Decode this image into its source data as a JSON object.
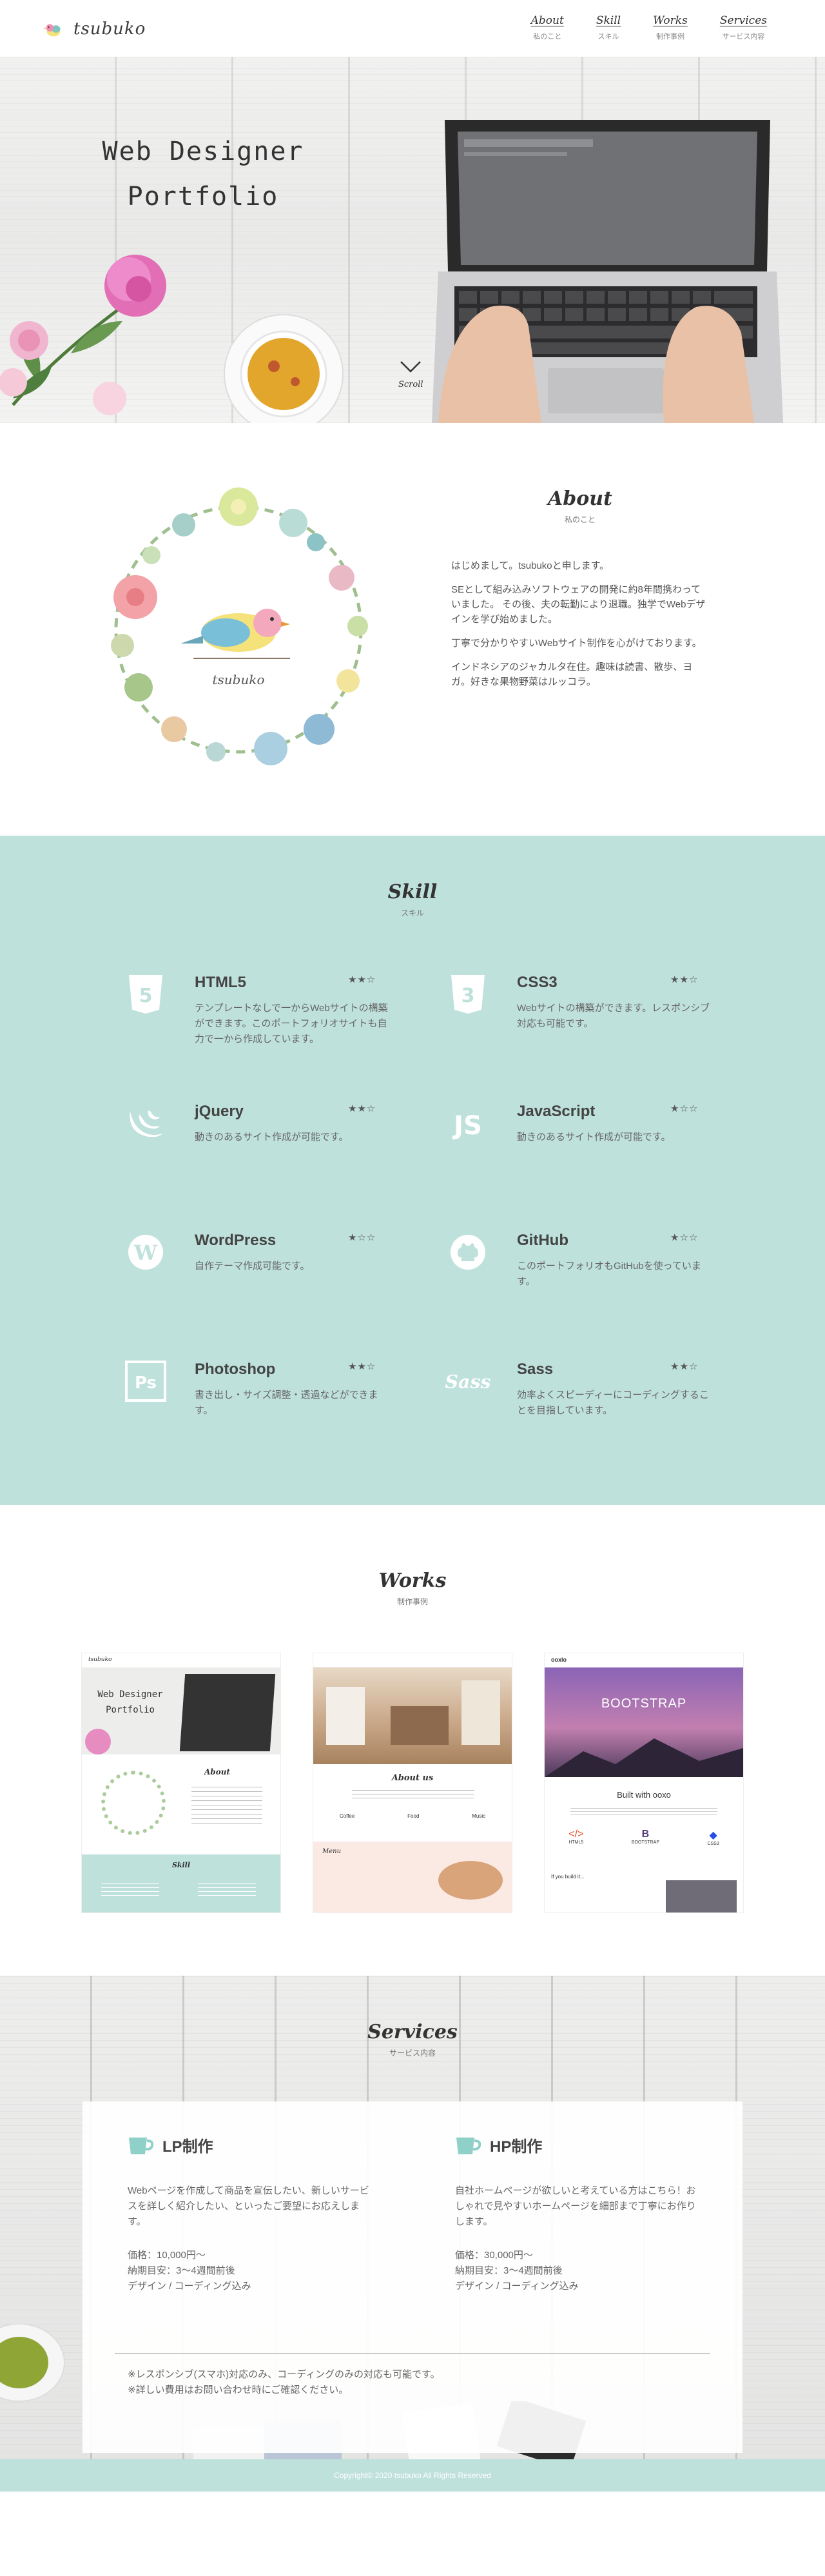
{
  "header": {
    "logo_text": "tsubuko",
    "nav": [
      {
        "label": "About",
        "sub": "私のこと"
      },
      {
        "label": "Skill",
        "sub": "スキル"
      },
      {
        "label": "Works",
        "sub": "制作事例"
      },
      {
        "label": "Services",
        "sub": "サービス内容"
      }
    ]
  },
  "hero": {
    "title_line1": "Web Designer",
    "title_line2": "Portfolio",
    "scroll_label": "Scroll"
  },
  "about": {
    "title": "About",
    "subtitle": "私のこと",
    "wreath_signature": "tsubuko",
    "paragraphs": [
      "はじめまして。tsubukoと申します。",
      "SEとして組み込みソフトウェアの開発に約8年間携わっていました。 その後、夫の転勤により退職。独学でWebデザインを学び始めました。",
      "丁寧で分かりやすいWebサイト制作を心がけております。",
      "インドネシアのジャカルタ在住。趣味は読書、散歩、ヨガ。好きな果物野菜はルッコラ。"
    ]
  },
  "skill": {
    "title": "Skill",
    "subtitle": "スキル",
    "items": [
      {
        "name": "HTML5",
        "stars": "★★☆",
        "desc": "テンプレートなしで一からWebサイトの構築ができます。このポートフォリオサイトも自力で一から作成しています。",
        "icon": "html5-icon"
      },
      {
        "name": "CSS3",
        "stars": "★★☆",
        "desc": "Webサイトの構築ができます。レスポンシブ対応も可能です。",
        "icon": "css3-icon"
      },
      {
        "name": "jQuery",
        "stars": "★★☆",
        "desc": "動きのあるサイト作成が可能です。",
        "icon": "jquery-icon"
      },
      {
        "name": "JavaScript",
        "stars": "★☆☆",
        "desc": "動きのあるサイト作成が可能です。",
        "icon": "javascript-icon"
      },
      {
        "name": "WordPress",
        "stars": "★☆☆",
        "desc": "自作テーマ作成可能です。",
        "icon": "wordpress-icon"
      },
      {
        "name": "GitHub",
        "stars": "★☆☆",
        "desc": "このポートフォリオもGitHubを使っています。",
        "icon": "github-icon"
      },
      {
        "name": "Photoshop",
        "stars": "★★☆",
        "desc": "書き出し・サイズ調整・透過などができます。",
        "icon": "photoshop-icon"
      },
      {
        "name": "Sass",
        "stars": "★★☆",
        "desc": "効率よくスピーディーにコーディングすることを目指しています。",
        "icon": "sass-icon"
      }
    ]
  },
  "works": {
    "title": "Works",
    "subtitle": "制作事例",
    "items": [
      {
        "t1": "Web Designer",
        "t2": "Portfolio",
        "about": "About",
        "skill": "Skill",
        "logo": "tsubuko"
      },
      {
        "heading": "About us",
        "menu": "Menu",
        "labels": [
          "Coffee",
          "Food",
          "Music"
        ]
      },
      {
        "brand": "ooxlo",
        "hero": "BOOTSTRAP",
        "built": "Built with ooxo",
        "features": [
          "HTML5",
          "BOOTSTRAP",
          "CSS3"
        ],
        "build": "If you build it..."
      }
    ]
  },
  "services": {
    "title": "Services",
    "subtitle": "サービス内容",
    "items": [
      {
        "name": "LP制作",
        "desc": "Webページを作成して商品を宣伝したい、新しいサービスを詳しく紹介したい、といったご要望にお応えします。",
        "price": "価格：10,000円〜",
        "period": "納期目安：3〜4週間前後",
        "scope": "デザイン / コーディング込み"
      },
      {
        "name": "HP制作",
        "desc": "自社ホームページが欲しいと考えている方はこちら！おしゃれで見やすいホームページを細部まで丁寧にお作りします。",
        "price": "価格：30,000円〜",
        "period": "納期目安：3〜4週間前後",
        "scope": "デザイン / コーディング込み"
      }
    ],
    "note1": "※レスポンシブ(スマホ)対応のみ、コーディングのみの対応も可能です。",
    "note2": "※詳しい費用はお問い合わせ時にご確認ください。"
  },
  "footer": {
    "copyright": "Copyright© 2020 tsubuko All Rights Reserved"
  },
  "colors": {
    "mint": "#bfe1dc",
    "text": "#555555",
    "heading": "#333333"
  }
}
